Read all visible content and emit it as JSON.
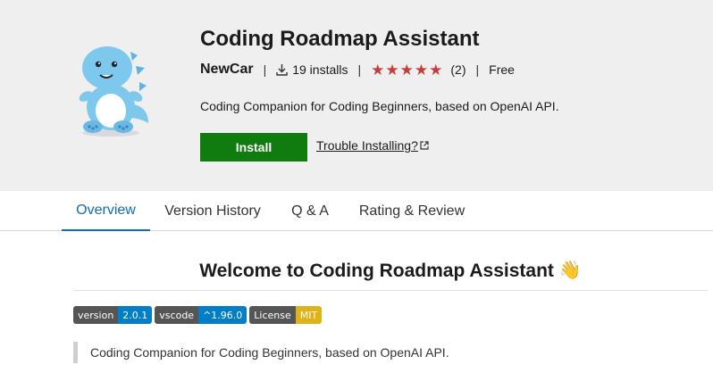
{
  "extension": {
    "title": "Coding Roadmap Assistant",
    "publisher": "NewCar",
    "installs": "19 installs",
    "rating_count": "(2)",
    "price": "Free",
    "rating": 5,
    "description": "Coding Companion for Coding Beginners, based on OpenAI API."
  },
  "actions": {
    "install_label": "Install",
    "trouble_label": "Trouble Installing?"
  },
  "tabs": [
    {
      "label": "Overview",
      "active": true
    },
    {
      "label": "Version History",
      "active": false
    },
    {
      "label": "Q & A",
      "active": false
    },
    {
      "label": "Rating & Review",
      "active": false
    }
  ],
  "content": {
    "welcome_heading": "Welcome to Coding Roadmap Assistant",
    "welcome_emoji": "👋",
    "badges": [
      {
        "label": "version",
        "value": "2.0.1",
        "color": "#007ec6"
      },
      {
        "label": "vscode",
        "value": "^1.96.0",
        "color": "#007ec6"
      },
      {
        "label": "License",
        "value": "MIT",
        "color": "#dfb317"
      }
    ],
    "quote": "Coding Companion for Coding Beginners, based on OpenAI API."
  },
  "colors": {
    "install_green": "#107c10",
    "star_red": "#c43f3b",
    "tab_active": "#0f6cbd"
  },
  "icons": {
    "logo": "blue-dinosaur-mascot",
    "installs": "download-icon",
    "star": "star-icon",
    "external": "external-link-icon"
  }
}
